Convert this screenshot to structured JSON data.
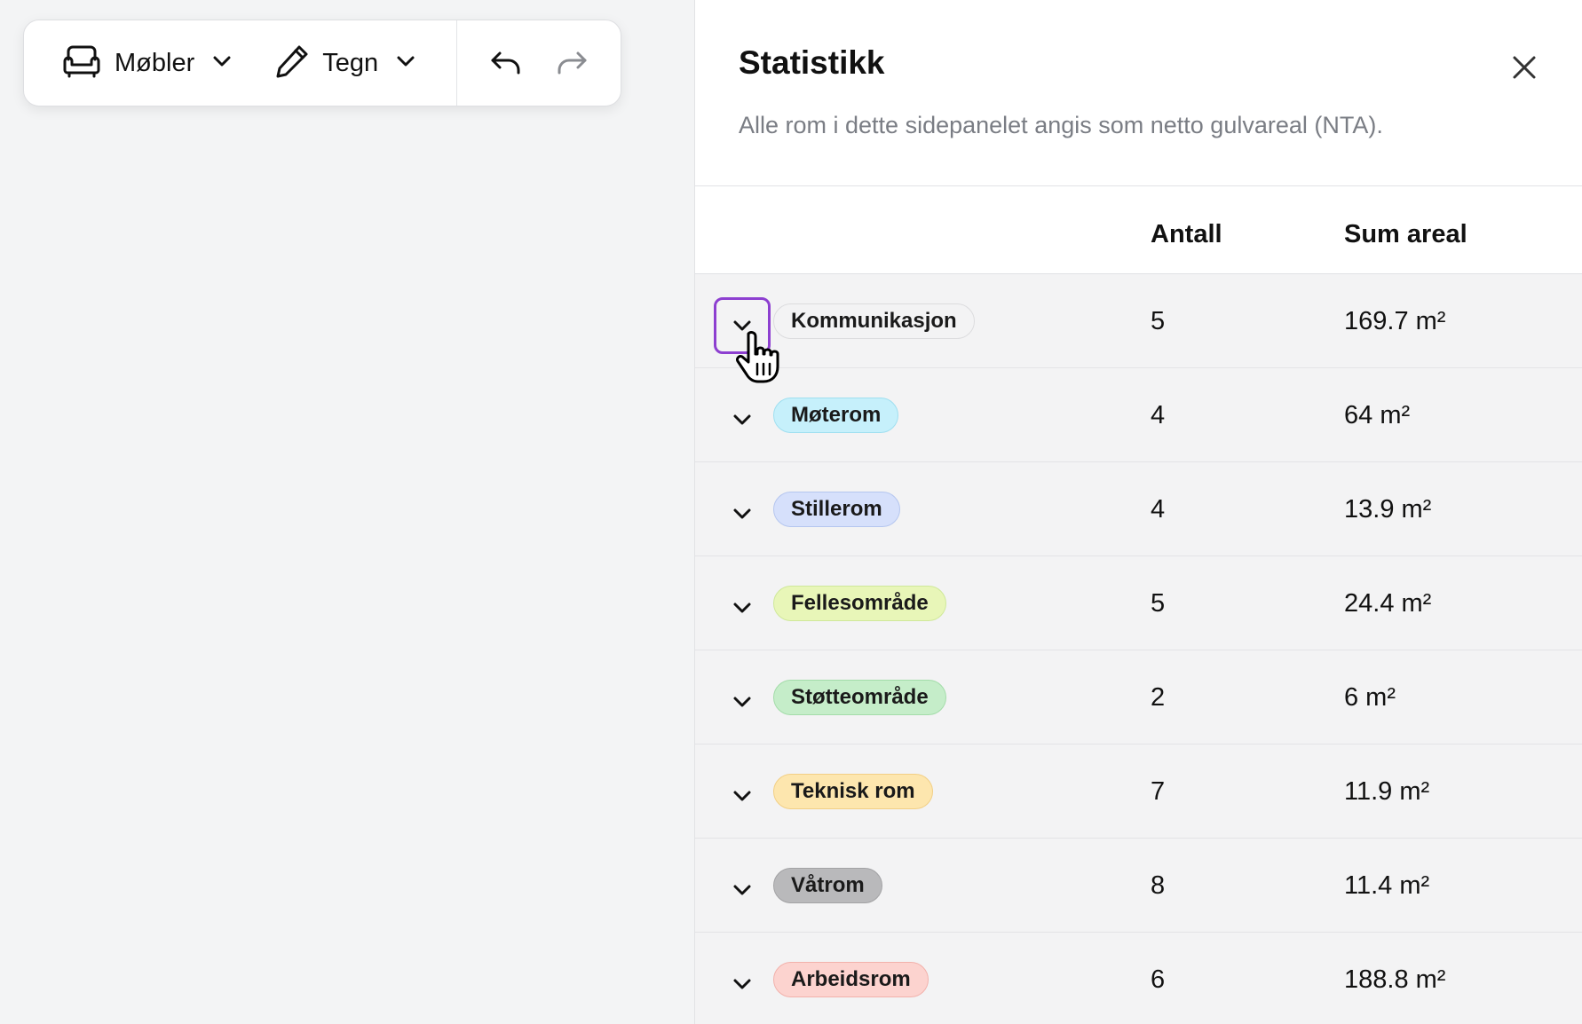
{
  "toolbar": {
    "furniture_label": "Møbler",
    "draw_label": "Tegn"
  },
  "panel": {
    "title": "Statistikk",
    "subtitle": "Alle rom i dette sidepanelet angis som netto gulvareal (NTA).",
    "columns": {
      "count": "Antall",
      "area": "Sum areal"
    },
    "rows": [
      {
        "label": "Kommunikasjon",
        "count": "5",
        "area": "169.7 m²",
        "bg": "#f3f3f4",
        "border": "#dcdcde"
      },
      {
        "label": "Møterom",
        "count": "4",
        "area": "64 m²",
        "bg": "#c6f0fb",
        "border": "#9fdff0"
      },
      {
        "label": "Stillerom",
        "count": "4",
        "area": "13.9 m²",
        "bg": "#d6e0fb",
        "border": "#b5c6ef"
      },
      {
        "label": "Fellesområde",
        "count": "5",
        "area": "24.4 m²",
        "bg": "#e8f6b8",
        "border": "#cfe89a"
      },
      {
        "label": "Støtteområde",
        "count": "2",
        "area": "6 m²",
        "bg": "#c5edc9",
        "border": "#a3dca9"
      },
      {
        "label": "Teknisk rom",
        "count": "7",
        "area": "11.9 m²",
        "bg": "#fde6ae",
        "border": "#f2cf85"
      },
      {
        "label": "Våtrom",
        "count": "8",
        "area": "11.4 m²",
        "bg": "#b9b9bb",
        "border": "#a2a2a4"
      },
      {
        "label": "Arbeidsrom",
        "count": "6",
        "area": "188.8 m²",
        "bg": "#fcd3cf",
        "border": "#f2b1ab"
      }
    ]
  },
  "colors": {
    "focus_ring": "#8d3fd0",
    "subtitle_text": "#7a7d84",
    "canvas_bg": "#f3f4f5"
  },
  "icons": [
    "sofa-icon",
    "pencil-icon",
    "chevron-down-icon",
    "undo-icon",
    "redo-icon",
    "close-icon",
    "hand-pointer-cursor"
  ]
}
